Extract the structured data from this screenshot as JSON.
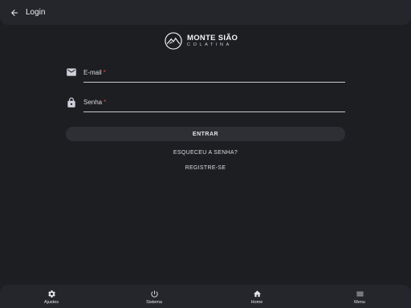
{
  "appbar": {
    "title": "Login",
    "back_icon": "arrow-left-icon"
  },
  "logo": {
    "main": "MONTE SIÃO",
    "sub": "COLATINA"
  },
  "form": {
    "email": {
      "label": "E-mail",
      "required_mark": "*",
      "icon": "mail-icon"
    },
    "password": {
      "label": "Senha",
      "required_mark": "*",
      "icon": "lock-icon"
    },
    "submit_label": "ENTRAR",
    "forgot_label": "ESQUECEU A SENHA?",
    "register_label": "REGISTRE-SE"
  },
  "bottom_nav": {
    "items": [
      {
        "label": "Ajustes",
        "icon": "gear-icon"
      },
      {
        "label": "Sistema",
        "icon": "power-icon"
      },
      {
        "label": "Home",
        "icon": "home-icon"
      },
      {
        "label": "Menu",
        "icon": "hamburger-menu-icon"
      }
    ]
  },
  "colors": {
    "background": "#1d1e22",
    "bar": "#25262b",
    "required": "#e54848"
  }
}
